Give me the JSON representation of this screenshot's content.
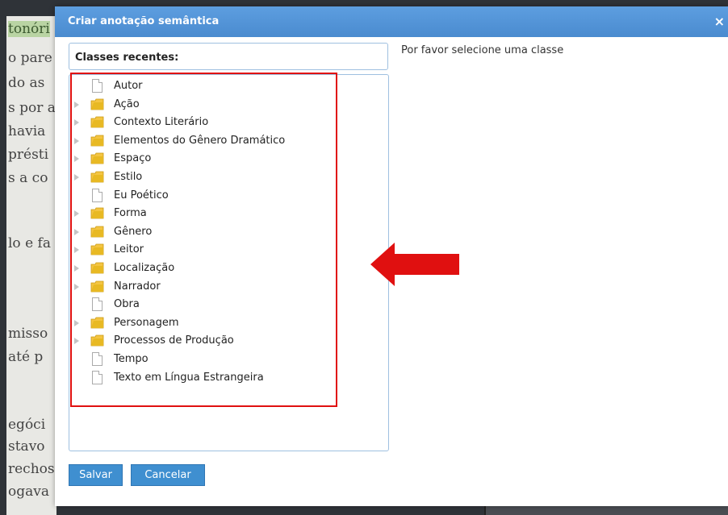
{
  "background": {
    "lines": [
      {
        "text": "tonóri",
        "highlight": true
      },
      {
        "text": "o pare"
      },
      {
        "text": "do as"
      },
      {
        "text": "s por a"
      },
      {
        "text": "havia"
      },
      {
        "text": "présti"
      },
      {
        "text": "s a co"
      },
      {
        "text": "lo e fa"
      },
      {
        "text": "misso"
      },
      {
        "text": "até p"
      },
      {
        "text": "egóci"
      },
      {
        "text": "stavo"
      },
      {
        "text": "rechos"
      },
      {
        "text": "ogava"
      }
    ]
  },
  "modal": {
    "title": "Criar anotação semântica",
    "close_symbol": "×",
    "recent_label": "Classes recentes:",
    "prompt": "Por favor selecione uma classe",
    "tree": [
      {
        "label": "Autor",
        "type": "document",
        "expandable": false
      },
      {
        "label": "Ação",
        "type": "folder",
        "expandable": true
      },
      {
        "label": "Contexto Literário",
        "type": "folder",
        "expandable": true
      },
      {
        "label": "Elementos do Gênero Dramático",
        "type": "folder",
        "expandable": true
      },
      {
        "label": "Espaço",
        "type": "folder",
        "expandable": true
      },
      {
        "label": "Estilo",
        "type": "folder",
        "expandable": true
      },
      {
        "label": "Eu Poético",
        "type": "document",
        "expandable": false
      },
      {
        "label": "Forma",
        "type": "folder",
        "expandable": true
      },
      {
        "label": "Gênero",
        "type": "folder",
        "expandable": true
      },
      {
        "label": "Leitor",
        "type": "folder",
        "expandable": true
      },
      {
        "label": "Localização",
        "type": "folder",
        "expandable": true
      },
      {
        "label": "Narrador",
        "type": "folder",
        "expandable": true
      },
      {
        "label": "Obra",
        "type": "document",
        "expandable": false
      },
      {
        "label": "Personagem",
        "type": "folder",
        "expandable": true
      },
      {
        "label": "Processos de Produção",
        "type": "folder",
        "expandable": true
      },
      {
        "label": "Tempo",
        "type": "document",
        "expandable": false
      },
      {
        "label": "Texto em Língua Estrangeira",
        "type": "document",
        "expandable": false
      }
    ],
    "buttons": {
      "save": "Salvar",
      "cancel": "Cancelar"
    }
  },
  "colors": {
    "header": "#4a8bcf",
    "button": "#3f8fd0",
    "annotation_red": "#e01010",
    "folder": "#e8b923"
  }
}
